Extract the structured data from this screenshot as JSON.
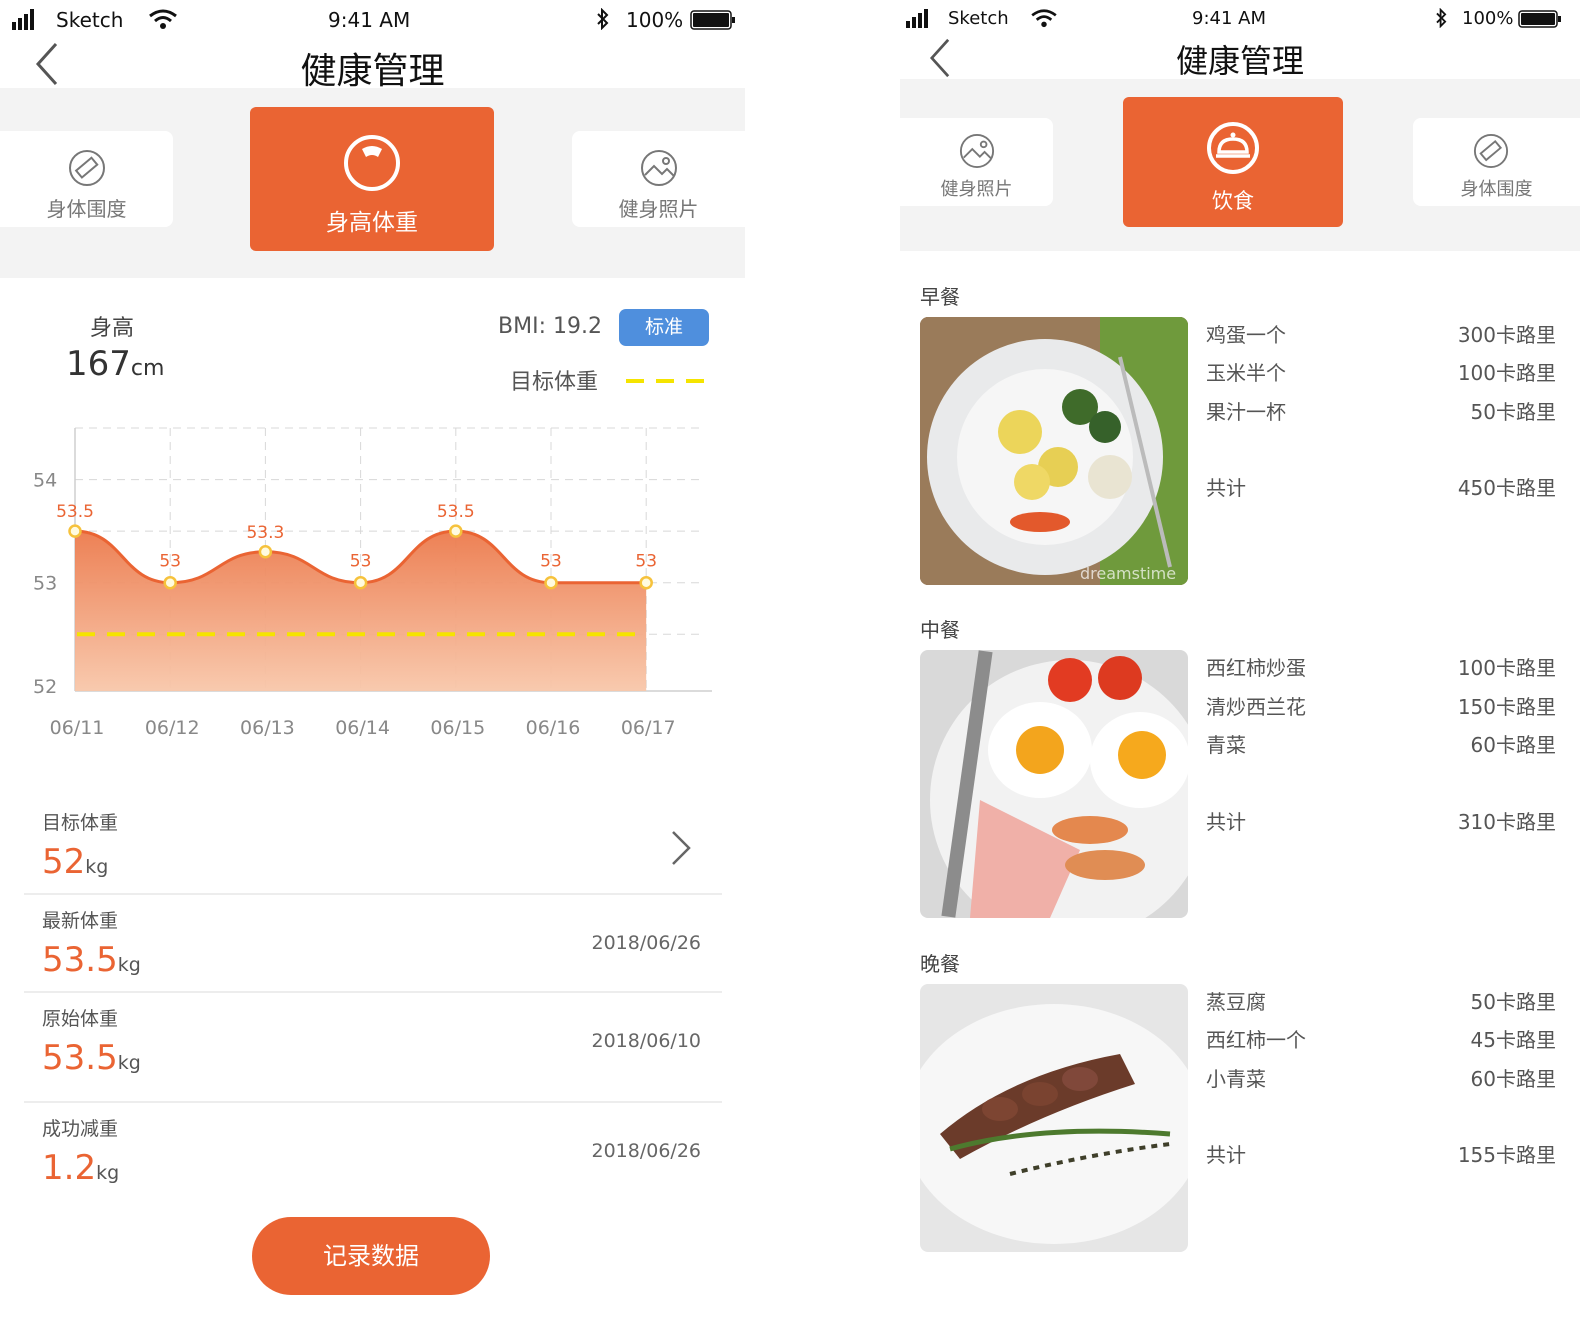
{
  "status": {
    "carrier": "Sketch",
    "time": "9:41 AM",
    "battery": "100%"
  },
  "left": {
    "title": "健康管理",
    "tabs": {
      "left": "身体围度",
      "active": "身高体重",
      "right": "健身照片"
    },
    "height": {
      "label": "身高",
      "value": "167",
      "unit": "cm"
    },
    "bmi": {
      "text": "BMI: 19.2",
      "badge": "标准"
    },
    "legend_target": "目标体重",
    "records": [
      {
        "label": "目标体重",
        "value": "52",
        "unit": "kg",
        "date": ""
      },
      {
        "label": "最新体重",
        "value": "53.5",
        "unit": "kg",
        "date": "2018/06/26"
      },
      {
        "label": "原始体重",
        "value": "53.5",
        "unit": "kg",
        "date": "2018/06/10"
      },
      {
        "label": "成功减重",
        "value": "1.2",
        "unit": "kg",
        "date": "2018/06/26"
      }
    ],
    "record_button": "记录数据"
  },
  "chart_data": {
    "type": "area",
    "categories": [
      "06/11",
      "06/12",
      "06/13",
      "06/14",
      "06/15",
      "06/16",
      "06/17"
    ],
    "series": [
      {
        "values": [
          53.5,
          53,
          53.3,
          53,
          53.5,
          53,
          53
        ],
        "labels": [
          "53.5",
          "53",
          "53.3",
          "53",
          "53.5",
          "53",
          "53"
        ]
      }
    ],
    "target": {
      "name": "目标体重",
      "value": 52.5
    },
    "yticks": [
      "52",
      "53",
      "54"
    ],
    "ylim": [
      51.95,
      54.5
    ],
    "grid": true,
    "colors": {
      "line": "#ea6433",
      "fill_top": "#ec7a4c",
      "fill_bottom": "#f8c7aa",
      "target": "#f5e400",
      "point_fill": "#fffbe0",
      "point_stroke": "#f6c23c"
    }
  },
  "right": {
    "title": "健康管理",
    "tabs": {
      "left": "健身照片",
      "active": "饮食",
      "right": "身体围度"
    },
    "meals": [
      {
        "name": "早餐",
        "items": [
          {
            "food": "鸡蛋一个",
            "cal": "300卡路里"
          },
          {
            "food": "玉米半个",
            "cal": "100卡路里"
          },
          {
            "food": "果汁一杯",
            "cal": "50卡路里"
          }
        ],
        "total_label": "共计",
        "total": "450卡路里",
        "image": "salad-plate-photo"
      },
      {
        "name": "中餐",
        "items": [
          {
            "food": "西红柿炒蛋",
            "cal": "100卡路里"
          },
          {
            "food": "清炒西兰花",
            "cal": "150卡路里"
          },
          {
            "food": "青菜",
            "cal": "60卡路里"
          }
        ],
        "total_label": "共计",
        "total": "310卡路里",
        "image": "fried-eggs-plate-photo"
      },
      {
        "name": "晚餐",
        "items": [
          {
            "food": "蒸豆腐",
            "cal": "50卡路里"
          },
          {
            "food": "西红柿一个",
            "cal": "45卡路里"
          },
          {
            "food": "小青菜",
            "cal": "60卡路里"
          }
        ],
        "total_label": "共计",
        "total": "155卡路里",
        "image": "steak-plate-photo"
      }
    ],
    "watermark": "dreamstime"
  },
  "colors": {
    "accent": "#ea6433",
    "badge": "#4f8fdd",
    "band": "#f3f3f3"
  }
}
